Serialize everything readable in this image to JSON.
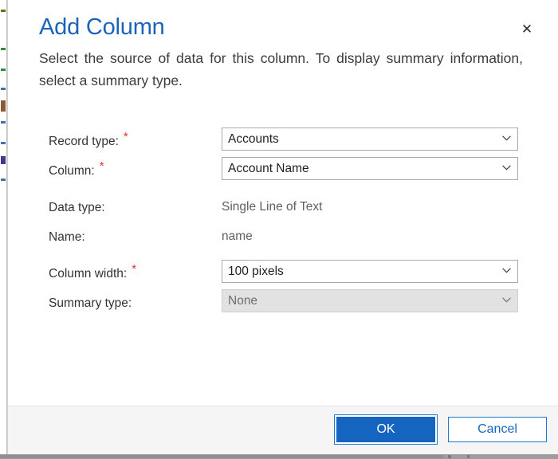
{
  "dialog": {
    "title": "Add Column",
    "description": "Select the source of data for this column. To display summary information, select a summary type.",
    "close_icon": "close-icon",
    "accent_color": "#1a63b8",
    "required_marker": "*",
    "required_color": "#d73a29"
  },
  "form": {
    "fields": [
      {
        "label": "Record type:",
        "required": true,
        "type": "dropdown",
        "value": "Accounts",
        "disabled": false,
        "chevron_icon": "chevron-down-icon"
      },
      {
        "label": "Column:",
        "required": true,
        "type": "dropdown",
        "value": "Account Name",
        "disabled": false,
        "chevron_icon": "chevron-down-icon"
      },
      {
        "label": "Data type:",
        "required": false,
        "type": "static",
        "value": "Single Line of Text"
      },
      {
        "label": "Name:",
        "required": false,
        "type": "static",
        "value": "name"
      },
      {
        "label": "Column width:",
        "required": true,
        "type": "dropdown",
        "value": "100 pixels",
        "disabled": false,
        "chevron_icon": "chevron-down-icon"
      },
      {
        "label": "Summary type:",
        "required": false,
        "type": "dropdown",
        "value": "None",
        "disabled": true,
        "chevron_icon": "chevron-down-icon"
      }
    ]
  },
  "footer": {
    "ok_label": "OK",
    "cancel_label": "Cancel",
    "primary_color": "#1565c0",
    "background": "#f5f5f5"
  }
}
